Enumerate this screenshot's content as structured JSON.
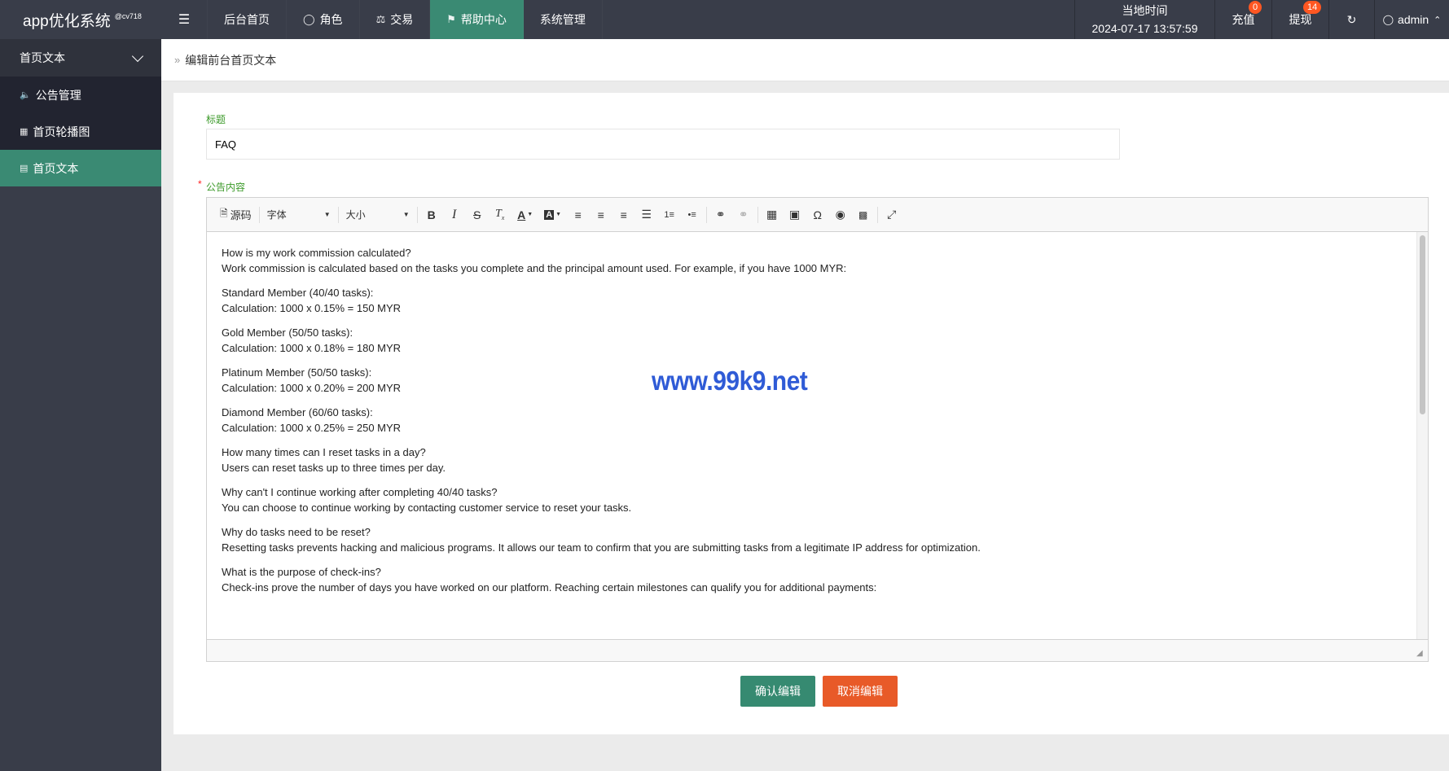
{
  "app": {
    "title": "app优化系统",
    "version_tag": "@cv718"
  },
  "topnav": {
    "toggle_icon": "menu-fold-icon",
    "items": [
      {
        "label": "后台首页",
        "icon": ""
      },
      {
        "label": "角色",
        "icon": "user-icon"
      },
      {
        "label": "交易",
        "icon": "scale-icon"
      },
      {
        "label": "帮助中心",
        "icon": "flag-icon",
        "active": true
      },
      {
        "label": "系统管理",
        "icon": ""
      }
    ]
  },
  "header_right": {
    "time_label": "当地时间",
    "time_value": "2024-07-17 13:57:59",
    "recharge_label": "充值",
    "recharge_count": "0",
    "withdraw_label": "提现",
    "withdraw_count": "14",
    "refresh_icon": "refresh-icon",
    "user_name": "admin"
  },
  "sidebar": {
    "group_label": "首页文本",
    "items": [
      {
        "label": "公告管理",
        "icon": "speaker-icon"
      },
      {
        "label": "首页轮播图",
        "icon": "image-icon"
      },
      {
        "label": "首页文本",
        "icon": "document-icon",
        "active": true
      }
    ]
  },
  "breadcrumb": {
    "current": "编辑前台首页文本"
  },
  "form": {
    "title_label": "标题",
    "title_value": "FAQ",
    "content_label": "公告内容",
    "required_mark": "*"
  },
  "toolbar": {
    "source_label": "源码",
    "font_label": "字体",
    "size_label": "大小"
  },
  "content": {
    "paragraphs": [
      [
        "How is my work commission calculated?",
        "Work commission is calculated based on the tasks you complete and the principal amount used. For example, if you have 1000 MYR:"
      ],
      [
        "Standard Member (40/40 tasks):",
        "Calculation: 1000 x 0.15% = 150 MYR"
      ],
      [
        "Gold Member (50/50 tasks):",
        "Calculation: 1000 x 0.18% = 180 MYR"
      ],
      [
        "Platinum Member (50/50 tasks):",
        "Calculation: 1000 x 0.20% = 200 MYR"
      ],
      [
        "Diamond Member (60/60 tasks):",
        "Calculation: 1000 x 0.25% = 250 MYR"
      ],
      [
        "How many times can I reset tasks in a day?",
        "Users can reset tasks up to three times per day."
      ],
      [
        "Why can't I continue working after completing 40/40 tasks?",
        "You can choose to continue working by contacting customer service to reset your tasks."
      ],
      [
        "Why do tasks need to be reset?",
        "Resetting tasks prevents hacking and malicious programs. It allows our team to confirm that you are submitting tasks from a legitimate IP address for optimization."
      ],
      [
        "What is the purpose of check-ins?",
        "Check-ins prove the number of days you have worked on our platform. Reaching certain milestones can qualify you for additional payments:"
      ]
    ]
  },
  "watermark": "www.99k9.net",
  "buttons": {
    "confirm": "确认编辑",
    "cancel": "取消编辑"
  },
  "colors": {
    "header_bg": "#393d49",
    "active_green": "#3a8a73",
    "badge": "#ff5722",
    "cancel_btn": "#e85a28",
    "label_green": "#3c9a2a",
    "watermark": "#2f5bd6"
  }
}
